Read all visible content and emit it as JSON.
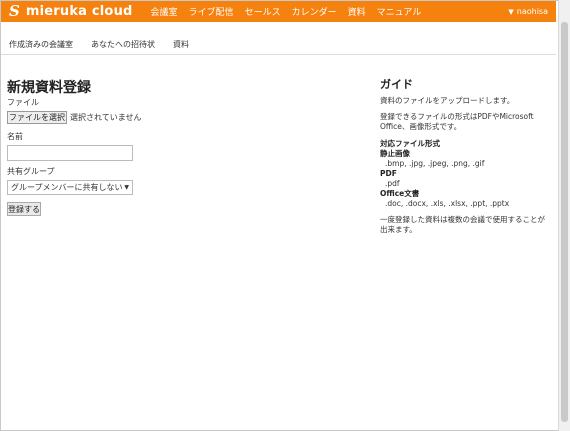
{
  "header": {
    "logo_mark": "S",
    "logo_text": "mieruka cloud",
    "nav": [
      "会議室",
      "ライブ配信",
      "セールス",
      "カレンダー",
      "資料",
      "マニュアル"
    ],
    "user": "naohisa",
    "colors": {
      "header_bg": "#f5820f"
    }
  },
  "subnav": {
    "items": [
      "作成済みの会議室",
      "あなたへの招待状",
      "資料"
    ]
  },
  "form": {
    "title": "新規資料登録",
    "file_label": "ファイル",
    "file_button": "ファイルを選択",
    "file_status": "選択されていません",
    "name_label": "名前",
    "name_value": "",
    "group_label": "共有グループ",
    "group_selected": "グループメンバーに共有しない",
    "submit_label": "登録する"
  },
  "guide": {
    "title": "ガイド",
    "intro": "資料のファイルをアップロードします。",
    "formats_text": "登録できるファイルの形式はPDFやMicrosoft Office、画像形式です。",
    "supported_heading": "対応ファイル形式",
    "image_heading": "静止画像",
    "image_exts": ".bmp, .jpg, .jpeg, .png, .gif",
    "pdf_heading": "PDF",
    "pdf_exts": ".pdf",
    "office_heading": "Office文書",
    "office_exts": ".doc, .docx, .xls, .xlsx, .ppt, .pptx",
    "note": "一度登録した資料は複数の会議で使用することが出来ます。"
  }
}
